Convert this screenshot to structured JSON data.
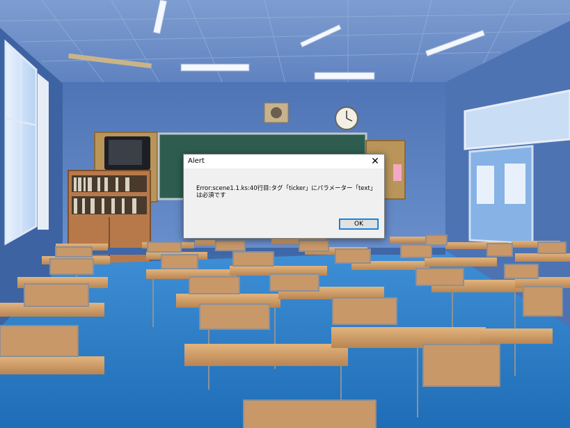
{
  "alert": {
    "title": "Alert",
    "close_glyph": "✕",
    "message": "Error:scene1.1.ks:40行目:タグ「ticker」にパラメーター「text」は必須です",
    "ok_label": "OK"
  },
  "colors": {
    "wall": "#5378b8",
    "ceiling": "#7f9ecf",
    "floor": "#2f7fc6",
    "chalkboard": "#2d5a4c",
    "desk_top": "#d2a06a",
    "accent_button": "#0078d7"
  }
}
